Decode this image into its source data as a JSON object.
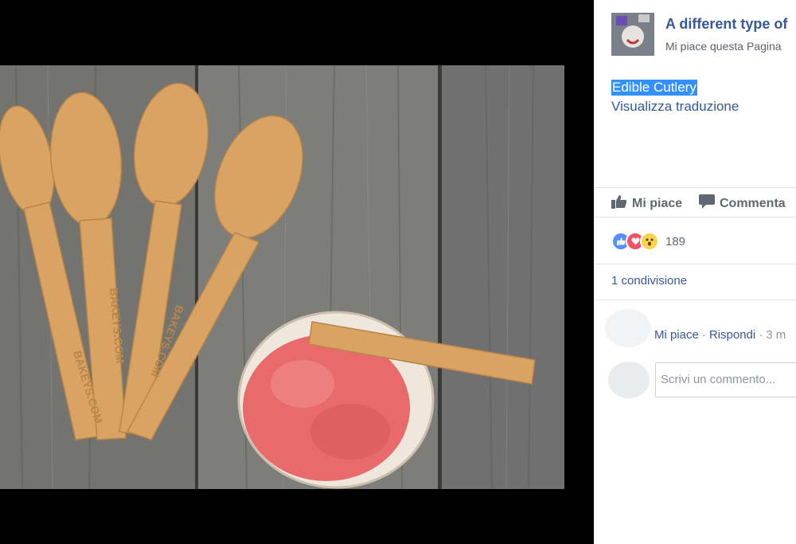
{
  "post": {
    "page_name": "A different type of",
    "page_like_status": "Mi piace questa Pagina",
    "text": "Edible Cutlery",
    "translate_link": "Visualizza traduzione"
  },
  "actions": {
    "like": "Mi piace",
    "comment": "Commenta"
  },
  "reactions": {
    "count": "189",
    "types": [
      "like-icon",
      "love-icon",
      "wow-icon"
    ]
  },
  "shares": "1 condivisione",
  "comment": {
    "like_link": "Mi piace",
    "reply_link": "Rispondi",
    "time": "3 m"
  },
  "composer": {
    "placeholder": "Scrivi un commento..."
  },
  "image": {
    "embossed_text": [
      "BAKEYS.COM",
      "BAKEYS.COM",
      "BAKEYS.COM"
    ]
  },
  "colors": {
    "link": "#365899",
    "highlight": "#3390ff",
    "wood": "#6f6f6c",
    "spoon": "#d9a363",
    "sorbet": "#e86a6a"
  }
}
